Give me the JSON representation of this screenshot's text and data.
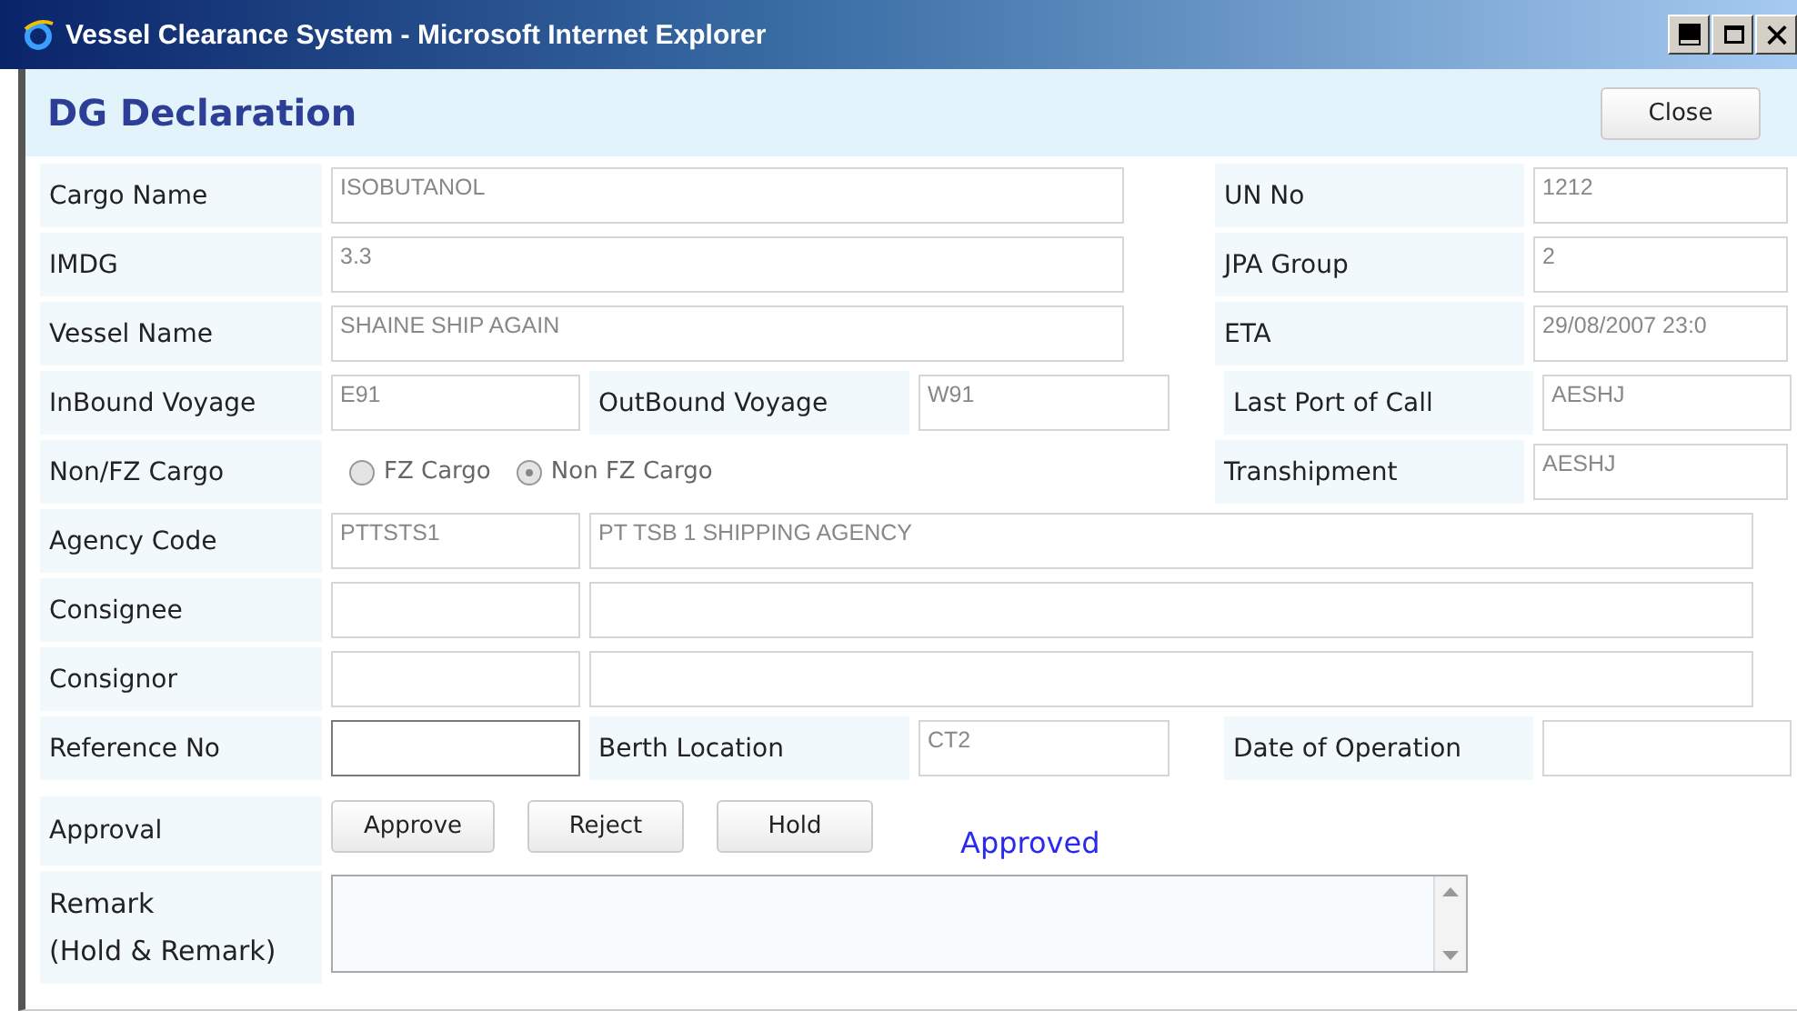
{
  "window": {
    "title": "Vessel Clearance System - Microsoft Internet Explorer"
  },
  "header": {
    "title": "DG Declaration",
    "close_button": "Close"
  },
  "rows": [
    {
      "kind": "wide",
      "cells": [
        {
          "kind": "label",
          "text": "Cargo Name"
        },
        {
          "kind": "field",
          "value": "ISOBUTANOL"
        },
        {
          "kind": "label",
          "text": "UN No"
        },
        {
          "kind": "field",
          "value": "1212"
        }
      ]
    },
    {
      "kind": "wide",
      "cells": [
        {
          "kind": "label",
          "text": "IMDG"
        },
        {
          "kind": "field",
          "value": "3.3"
        },
        {
          "kind": "label",
          "text": "JPA Group"
        },
        {
          "kind": "field",
          "value": "2"
        }
      ]
    },
    {
      "kind": "wide",
      "cells": [
        {
          "kind": "label",
          "text": "Vessel Name"
        },
        {
          "kind": "field",
          "value": "SHAINE SHIP AGAIN"
        },
        {
          "kind": "label",
          "text": "ETA"
        },
        {
          "kind": "field",
          "value": "29/08/2007 23:0"
        }
      ]
    },
    {
      "kind": "split",
      "cells": [
        {
          "kind": "label",
          "text": "InBound Voyage"
        },
        {
          "kind": "field",
          "value": "E91"
        },
        {
          "kind": "label",
          "text": "OutBound Voyage"
        },
        {
          "kind": "field",
          "value": "W91"
        },
        {
          "kind": "label",
          "text": "Last Port of Call"
        },
        {
          "kind": "field",
          "value": "AESHJ"
        }
      ]
    },
    {
      "kind": "choice",
      "cells": [
        {
          "kind": "label",
          "text": "Non/FZ Cargo"
        },
        {
          "kind": "radios",
          "options": [
            {
              "label": "FZ Cargo",
              "selected": false
            },
            {
              "label": "Non FZ Cargo",
              "selected": true
            }
          ]
        },
        {
          "kind": "label",
          "text": "Transhipment"
        },
        {
          "kind": "field",
          "value": "AESHJ"
        }
      ]
    },
    {
      "kind": "party",
      "cells": [
        {
          "kind": "label",
          "text": "Agency Code"
        },
        {
          "kind": "field",
          "value": "PTTSTS1"
        },
        {
          "kind": "field",
          "value": "PT TSB 1 SHIPPING AGENCY"
        }
      ]
    },
    {
      "kind": "party",
      "cells": [
        {
          "kind": "label",
          "text": "Consignee"
        },
        {
          "kind": "field"
        },
        {
          "kind": "field"
        }
      ]
    },
    {
      "kind": "party",
      "cells": [
        {
          "kind": "label",
          "text": "Consignor"
        },
        {
          "kind": "field"
        },
        {
          "kind": "field"
        }
      ]
    },
    {
      "kind": "split",
      "cells": [
        {
          "kind": "label",
          "text": "Reference No"
        },
        {
          "kind": "field",
          "editable": true
        },
        {
          "kind": "label",
          "text": "Berth Location"
        },
        {
          "kind": "field",
          "value": "CT2"
        },
        {
          "kind": "label",
          "text": "Date of Operation"
        },
        {
          "kind": "field"
        }
      ]
    }
  ],
  "approval": {
    "label": "Approval",
    "buttons": [
      "Approve",
      "Reject",
      "Hold"
    ],
    "status": "Approved"
  },
  "remark": {
    "label": "Remark",
    "sublabel": "(Hold & Remark)"
  }
}
